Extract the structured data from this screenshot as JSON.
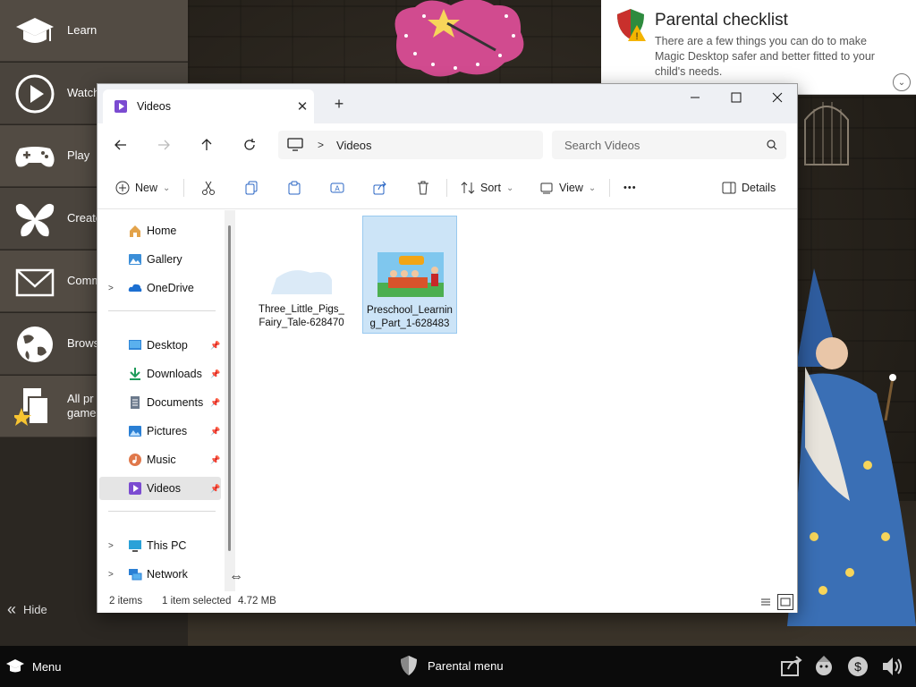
{
  "left_menu": {
    "items": [
      {
        "label": "Learn",
        "icon": "graduation-cap-icon"
      },
      {
        "label": "Watch",
        "icon": "play-icon"
      },
      {
        "label": "Play",
        "icon": "gamepad-icon"
      },
      {
        "label": "Create",
        "icon": "butterfly-icon"
      },
      {
        "label": "Comm",
        "icon": "envelope-icon"
      },
      {
        "label": "Brows",
        "icon": "globe-icon"
      },
      {
        "label": "All pr\ngame",
        "icon": "all-programs-icon"
      }
    ],
    "hide_label": "Hide"
  },
  "parental_checklist": {
    "title": "Parental checklist",
    "description": "There are a few things you can do to make Magic Desktop safer and better fitted to your child's needs."
  },
  "explorer": {
    "tab_label": "Videos",
    "breadcrumb": "Videos",
    "search_placeholder": "Search Videos",
    "commands": {
      "new": "New",
      "sort": "Sort",
      "view": "View",
      "more": "•••",
      "details": "Details"
    },
    "nav": {
      "home": "Home",
      "gallery": "Gallery",
      "onedrive": "OneDrive",
      "desktop": "Desktop",
      "downloads": "Downloads",
      "documents": "Documents",
      "pictures": "Pictures",
      "music": "Music",
      "videos": "Videos",
      "this_pc": "This PC",
      "network": "Network"
    },
    "files": [
      {
        "name": "Three_Little_Pigs_Fairy_Tale-628470",
        "selected": false
      },
      {
        "name": "Preschool_Learning_Part_1-628483",
        "selected": true
      }
    ],
    "status": {
      "count": "2 items",
      "selected": "1 item selected",
      "size": "4.72 MB"
    }
  },
  "taskbar": {
    "menu_label": "Menu",
    "parental_label": "Parental menu"
  },
  "colors": {
    "menu_bg": "#524b43",
    "selection": "#cce4f7",
    "taskbar": "#0b0b0b"
  }
}
